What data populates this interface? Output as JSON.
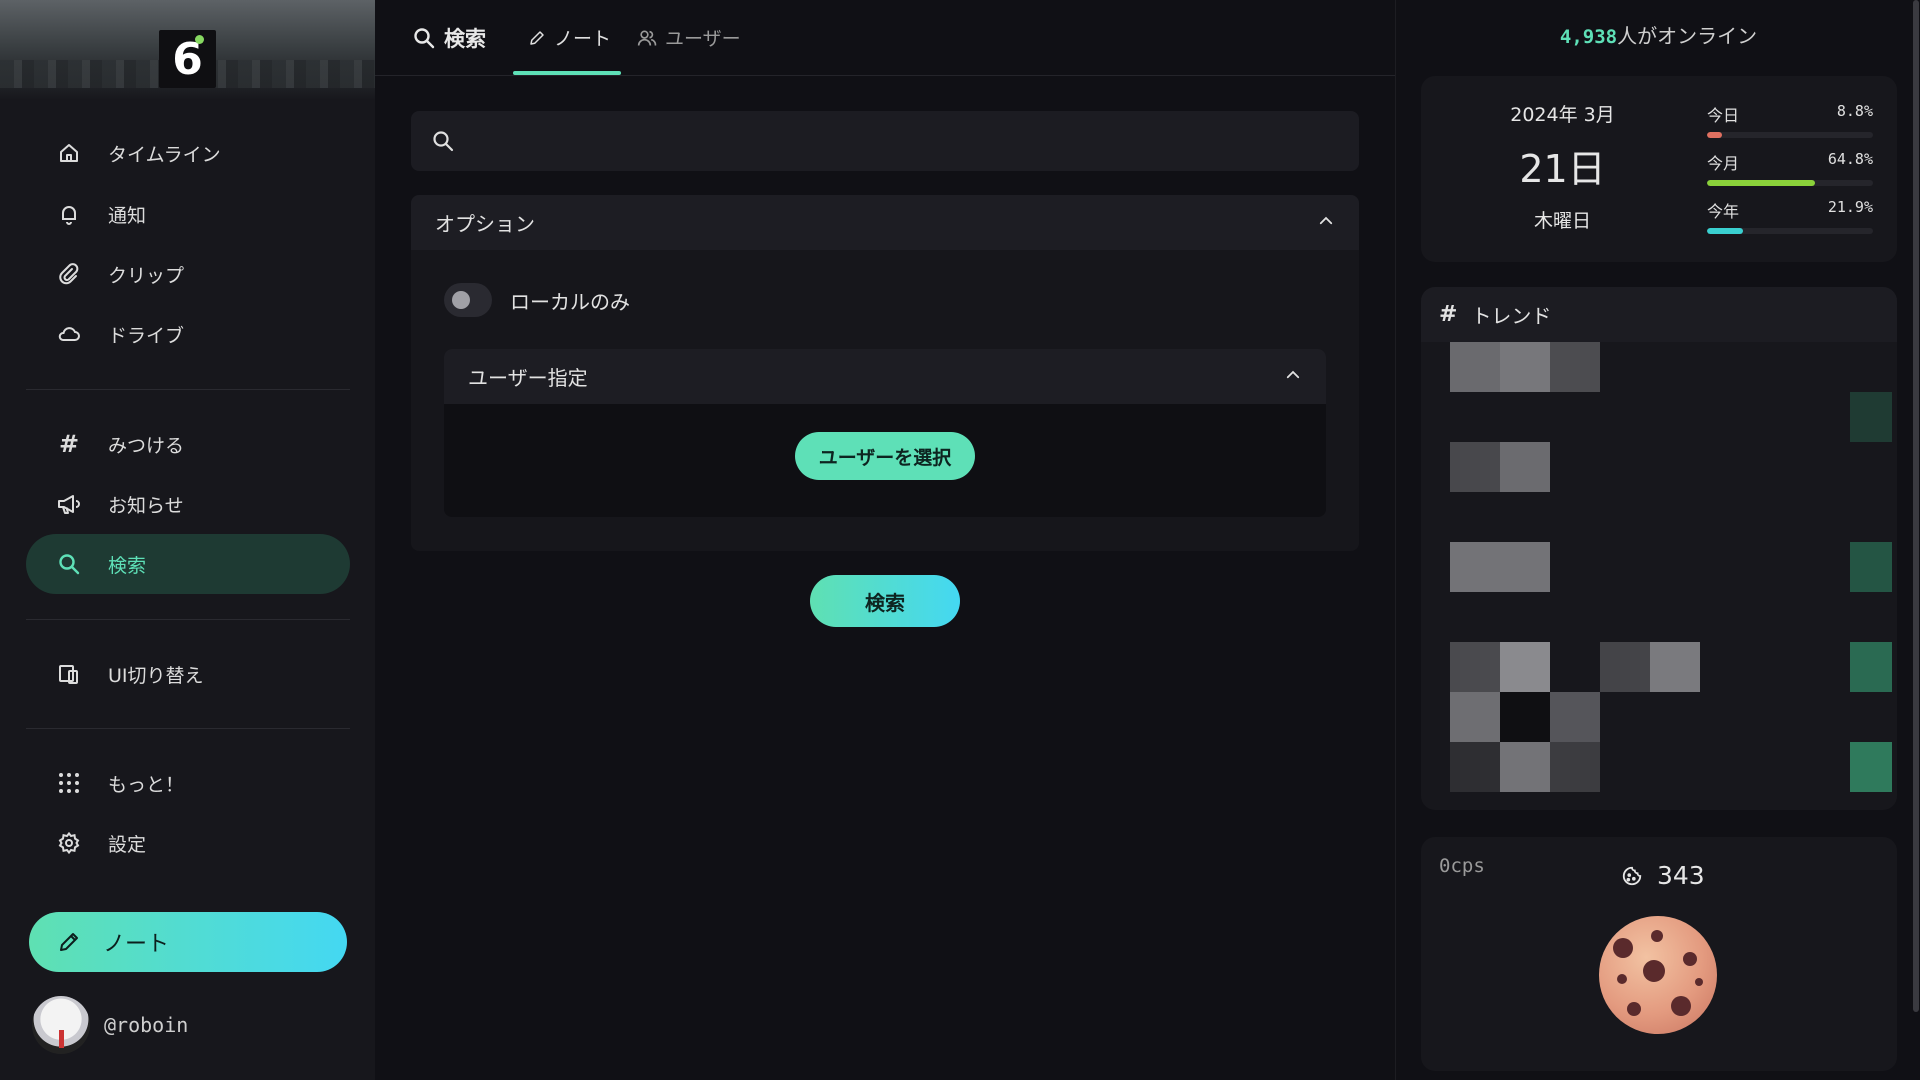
{
  "sidebar": {
    "items": [
      {
        "label": "タイムライン",
        "icon": "home-icon"
      },
      {
        "label": "通知",
        "icon": "bell-icon"
      },
      {
        "label": "クリップ",
        "icon": "paperclip-icon"
      },
      {
        "label": "ドライブ",
        "icon": "cloud-icon"
      },
      {
        "label": "みつける",
        "icon": "hashtag-icon"
      },
      {
        "label": "お知らせ",
        "icon": "megaphone-icon"
      },
      {
        "label": "検索",
        "icon": "search-icon",
        "active": true
      },
      {
        "label": "UI切り替え",
        "icon": "devices-icon"
      },
      {
        "label": "もっと！",
        "icon": "grid-dots-icon"
      },
      {
        "label": "設定",
        "icon": "gear-icon"
      }
    ],
    "note_button": "ノート",
    "username": "@roboin"
  },
  "tabs": {
    "search": "検索",
    "note": "ノート",
    "user": "ユーザー"
  },
  "search": {
    "value": "",
    "placeholder": ""
  },
  "options": {
    "title": "オプション",
    "local_only": "ローカルのみ",
    "local_only_checked": false,
    "user_spec_title": "ユーザー指定",
    "select_user": "ユーザーを選択"
  },
  "search_button": "検索",
  "online": {
    "count": "4,938",
    "suffix": "人がオンライン"
  },
  "calendar": {
    "year_month": "2024年 3月",
    "day": "21日",
    "weekday": "木曜日",
    "stats": [
      {
        "label": "今日",
        "value": "8.8%",
        "fraction": 0.088,
        "color": "#e07060"
      },
      {
        "label": "今月",
        "value": "64.8%",
        "fraction": 0.648,
        "color": "#8ad13a"
      },
      {
        "label": "今年",
        "value": "21.9%",
        "fraction": 0.219,
        "color": "#3ad0d0"
      }
    ]
  },
  "trend": {
    "title": "トレンド"
  },
  "cookie": {
    "cps": "0cps",
    "count": "343"
  },
  "colors": {
    "accent": "#5ee0b7",
    "accent_gradient_end": "#44d8f2",
    "background": "#101015",
    "panel": "#17171c"
  }
}
